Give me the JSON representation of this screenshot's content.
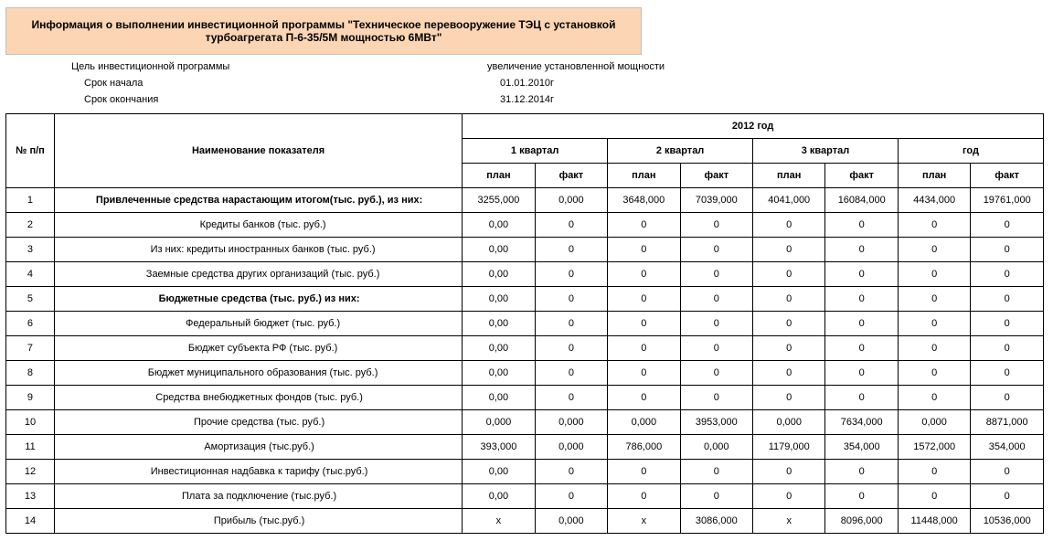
{
  "title": "Информация о выполнении инвестиционной программы \"Техническое перевооружение ТЭЦ с установкой турбоагрегата П-6-35/5М мощностью 6МВт\"",
  "info": {
    "goal_label": "Цель инвестиционной программы",
    "goal_value": "увеличение установленной мощности",
    "start_label": "Срок начала",
    "start_value": "01.01.2010г",
    "end_label": "Срок окончания",
    "end_value": "31.12.2014г"
  },
  "headers": {
    "num": "№ п/п",
    "name": "Наименование показателя",
    "year": "2012 год",
    "q1": "1 квартал",
    "q2": "2 квартал",
    "q3": "3 квартал",
    "yr": "год",
    "plan": "план",
    "fact": "факт"
  },
  "rows": [
    {
      "n": "1",
      "name": "Привлеченные средства нарастающим итогом(тыс. руб.), из них:",
      "bold": true,
      "indent": 0,
      "v": [
        "3255,000",
        "0,000",
        "3648,000",
        "7039,000",
        "4041,000",
        "16084,000",
        "4434,000",
        "19761,000"
      ]
    },
    {
      "n": "2",
      "name": "Кредиты банков (тыс. руб.)",
      "bold": false,
      "indent": 1,
      "v": [
        "0,00",
        "0",
        "0",
        "0",
        "0",
        "0",
        "0",
        "0"
      ]
    },
    {
      "n": "3",
      "name": "Из них: кредиты иностранных банков (тыс. руб.)",
      "bold": false,
      "indent": 1,
      "v": [
        "0,00",
        "0",
        "0",
        "0",
        "0",
        "0",
        "0",
        "0"
      ]
    },
    {
      "n": "4",
      "name": "Заемные средства других организаций (тыс. руб.)",
      "bold": false,
      "indent": 1,
      "v": [
        "0,00",
        "0",
        "0",
        "0",
        "0",
        "0",
        "0",
        "0"
      ]
    },
    {
      "n": "5",
      "name": "Бюджетные средства (тыс. руб.) из них:",
      "bold": true,
      "indent": 0,
      "v": [
        "0,00",
        "0",
        "0",
        "0",
        "0",
        "0",
        "0",
        "0"
      ]
    },
    {
      "n": "6",
      "name": "Федеральный бюджет (тыс. руб.)",
      "bold": false,
      "indent": 1,
      "v": [
        "0,00",
        "0",
        "0",
        "0",
        "0",
        "0",
        "0",
        "0"
      ]
    },
    {
      "n": "7",
      "name": "Бюджет субъекта РФ (тыс. руб.)",
      "bold": false,
      "indent": 1,
      "v": [
        "0,00",
        "0",
        "0",
        "0",
        "0",
        "0",
        "0",
        "0"
      ]
    },
    {
      "n": "8",
      "name": "Бюджет муниципального образования (тыс. руб.)",
      "bold": false,
      "indent": 1,
      "v": [
        "0,00",
        "0",
        "0",
        "0",
        "0",
        "0",
        "0",
        "0"
      ]
    },
    {
      "n": "9",
      "name": "Средства внебюджетных фондов (тыс. руб.)",
      "bold": false,
      "indent": 0,
      "v": [
        "0,00",
        "0",
        "0",
        "0",
        "0",
        "0",
        "0",
        "0"
      ]
    },
    {
      "n": "10",
      "name": "Прочие средства (тыс. руб.)",
      "bold": false,
      "indent": 0,
      "v": [
        "0,000",
        "0,000",
        "0,000",
        "3953,000",
        "0,000",
        "7634,000",
        "0,000",
        "8871,000"
      ]
    },
    {
      "n": "11",
      "name": "Амортизация (тыс.руб.)",
      "bold": false,
      "indent": 0,
      "v": [
        "393,000",
        "0,000",
        "786,000",
        "0,000",
        "1179,000",
        "354,000",
        "1572,000",
        "354,000"
      ]
    },
    {
      "n": "12",
      "name": "Инвестиционная надбавка к тарифу (тыс.руб.)",
      "bold": false,
      "indent": 0,
      "v": [
        "0,00",
        "0",
        "0",
        "0",
        "0",
        "0",
        "0",
        "0"
      ]
    },
    {
      "n": "13",
      "name": "Плата за подключение (тыс.руб.)",
      "bold": false,
      "indent": 0,
      "v": [
        "0,00",
        "0",
        "0",
        "0",
        "0",
        "0",
        "0",
        "0"
      ]
    },
    {
      "n": "14",
      "name": "Прибыль (тыс.руб.)",
      "bold": false,
      "indent": 0,
      "v": [
        "x",
        "0,000",
        "x",
        "3086,000",
        "x",
        "8096,000",
        "11448,000",
        "10536,000"
      ]
    }
  ]
}
